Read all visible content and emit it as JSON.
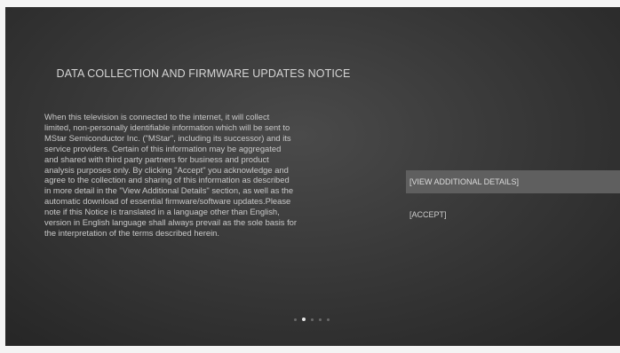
{
  "notice": {
    "title": "DATA COLLECTION AND FIRMWARE UPDATES NOTICE",
    "body_lines": [
      "When this television is connected to the internet, it will collect",
      "limited, non-personally identifiable information which will be sent to",
      "MStar Semiconductor Inc. (\"MStar\", including its successor) and its",
      "service providers. Certain of this information may be aggregated",
      "and shared with third party partners for business and product",
      "analysis purposes only. By clicking \"Accept\" you acknowledge and",
      "agree to the collection and sharing of this information as described",
      "in more detail in the \"View Additional Details\" section, as well as the",
      "automatic download of essential firmware/software updates.Please",
      "note if this Notice is translated in a language other than English,",
      "version in English language shall always prevail as the sole basis for",
      "the interpretation of the terms described herein."
    ]
  },
  "options": {
    "view_details": "[VIEW ADDITIONAL DETAILS]",
    "accept": "[ACCEPT]",
    "selected": "view_details"
  },
  "pagination": {
    "total": 5,
    "current": 2
  },
  "colors": {
    "background": "#3a3a3a",
    "highlight": "#5f5f5f",
    "text": "#c9c9c9"
  }
}
